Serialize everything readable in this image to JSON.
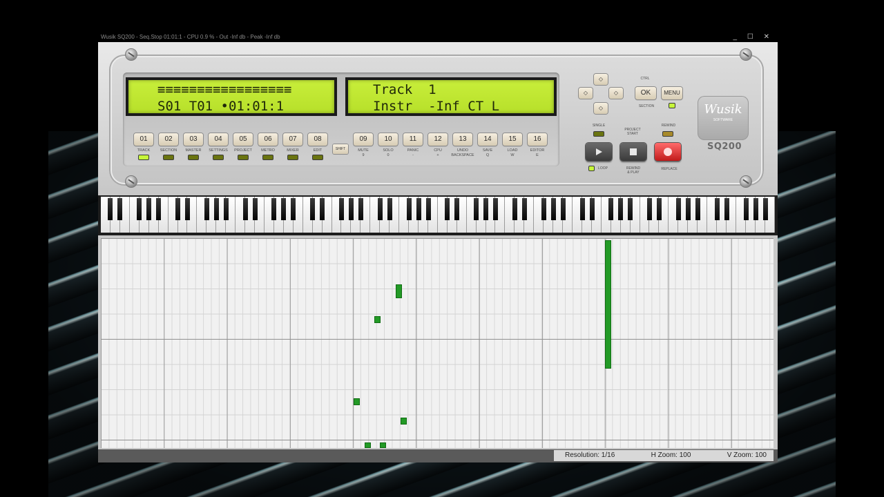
{
  "window": {
    "title": "Wusik SQ200  -  Seq.Stop 01:01:1  -  CPU   0.9 %  -  Out  -Inf db  -  Peak  -Inf db",
    "controls": "_ ☐ ✕"
  },
  "lcd": {
    "left_line1": "≡≡≡≡≡≡≡≡≡≡≡≡≡≡≡≡≡",
    "left_line2": "S01 T01 •01:01:1",
    "right_line1": "Track  1",
    "right_line2": "Instr  -Inf CT L"
  },
  "buttons": {
    "left": [
      "01",
      "02",
      "03",
      "04",
      "05",
      "06",
      "07",
      "08"
    ],
    "left_labels": [
      "TRACK",
      "SECTION",
      "MASTER",
      "SETTINGS",
      "PROJECT",
      "METRO",
      "MIXER",
      "EDIT"
    ],
    "shift": "SHIFT",
    "right": [
      "09",
      "10",
      "11",
      "12",
      "13",
      "14",
      "15",
      "16"
    ],
    "right_labels": [
      "MUTE\n9",
      "SOLO\n0",
      "PANIC\n-",
      "CPU\n+",
      "UNDO\nBACKSPACE",
      "SAVE\nQ",
      "LOAD\nW",
      "EDITOR\nE"
    ]
  },
  "nav": {
    "up": "◇",
    "down": "◇",
    "left": "◇",
    "right": "◇",
    "ctrl_label": "CTRL",
    "ok": "OK",
    "menu": "MENU",
    "section_label": "SECTION"
  },
  "transport": {
    "single": "SINGLE",
    "project_start": "PROJECT\nSTART",
    "rewind": "REWIND",
    "loop": "LOOP",
    "rewind_play": "REWIND\n& PLAY",
    "replace": "REPLACE"
  },
  "logo": {
    "name": "Wusik",
    "tag": "SOFTWARE",
    "model": "SQ200"
  },
  "status": {
    "resolution": "Resolution: 1/16",
    "hzoom": "H Zoom: 100",
    "vzoom": "V Zoom: 100"
  },
  "colors": {
    "lcd": "#c2ea35",
    "note": "#239a26",
    "record": "#e02a2a"
  }
}
